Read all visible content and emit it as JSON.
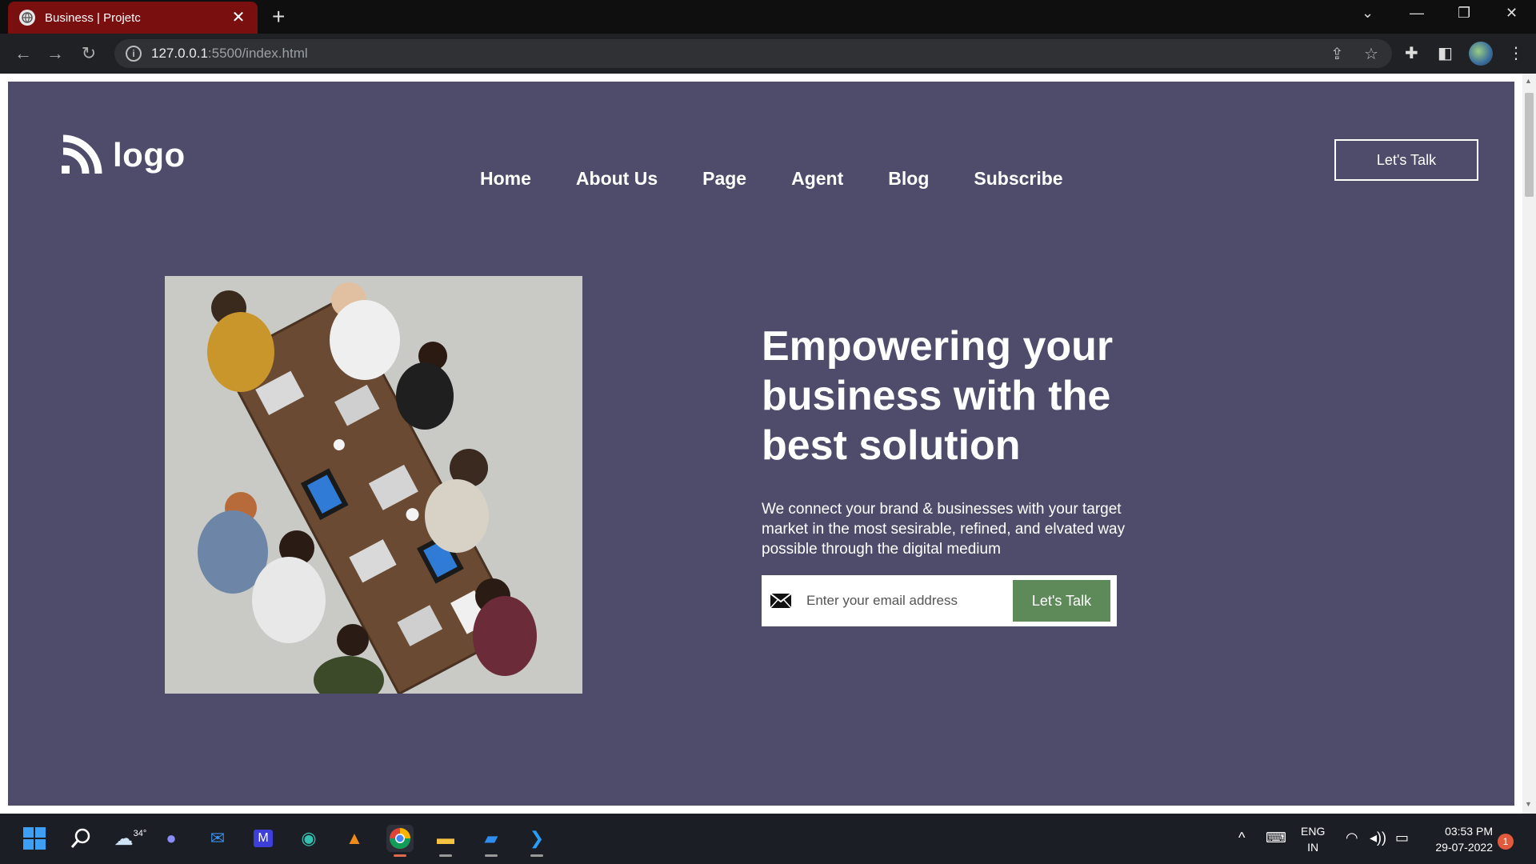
{
  "browser": {
    "tab_title": "Business | Projetc",
    "tab_close": "✕",
    "new_tab": "+",
    "url_host": "127.0.0.1",
    "url_path": ":5500/index.html"
  },
  "site": {
    "logo_text": "logo",
    "nav": [
      "Home",
      "About Us",
      "Page",
      "Agent",
      "Blog",
      "Subscribe"
    ],
    "header_cta": "Let's Talk",
    "headline": "Empowering your business with the best solution",
    "subtext": "We connect your brand & businesses with your target market in the most sesirable, refined, and elvated way possible through the digital medium",
    "email_placeholder": "Enter your email address",
    "form_cta": "Let's Talk",
    "bg_color": "#4e4c6a",
    "cta_color": "#5e8a5a"
  },
  "taskbar": {
    "weather": "34°",
    "lang_top": "ENG",
    "lang_bottom": "IN",
    "time": "03:53 PM",
    "date": "29-07-2022",
    "notifications": "1"
  }
}
